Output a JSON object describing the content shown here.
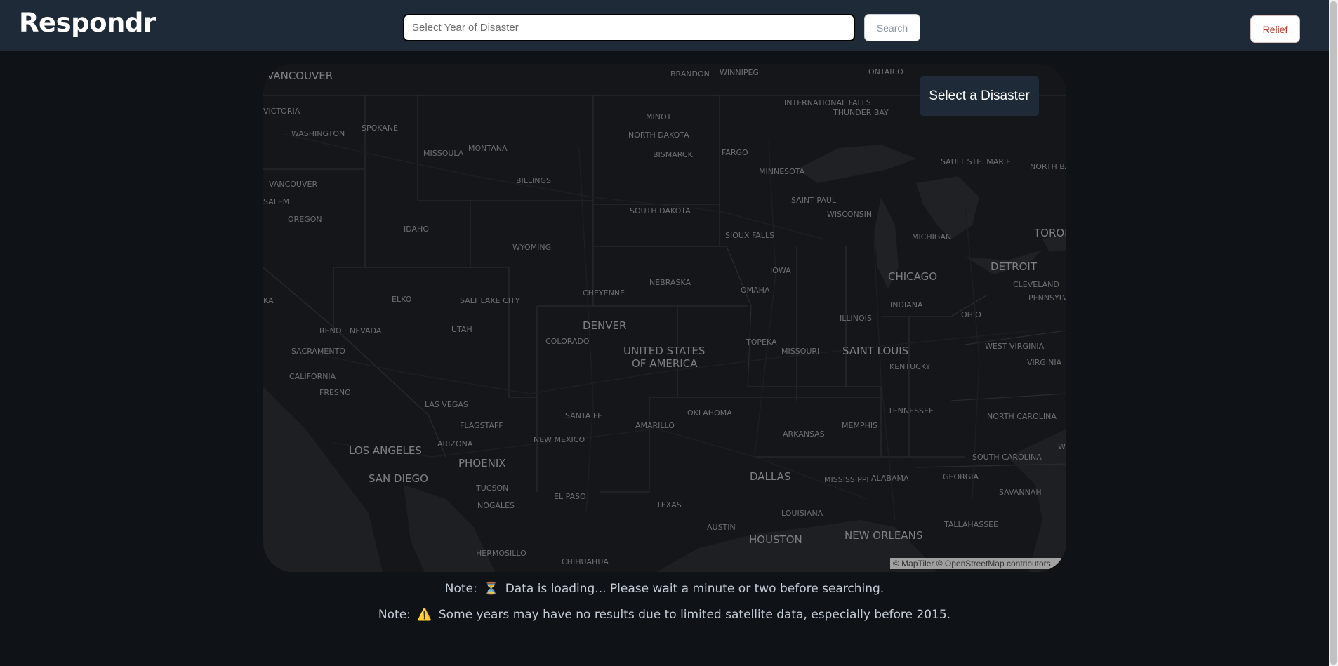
{
  "header": {
    "brand": "Respondr",
    "search_placeholder": "Select Year of Disaster",
    "search_label": "Search",
    "relief_label": "Relief"
  },
  "map": {
    "select_label": "Select a Disaster",
    "attribution": "© MapTiler © OpenStreetMap contributors",
    "labels": {
      "vancouver": "Vancouver",
      "victoria": "Victoria",
      "washington": "Washington",
      "spokane": "Spokane",
      "missoula": "Missoula",
      "montana": "Montana",
      "vancouver_wa": "Vancouver",
      "salem": "Salem",
      "oregon": "Oregon",
      "billings": "Billings",
      "idaho": "Idaho",
      "wyoming": "Wyoming",
      "brandon": "Brandon",
      "winnipeg": "Winnipeg",
      "ontario": "Ontario",
      "minot": "Minot",
      "north_dakota": "North Dakota",
      "bismarck": "Bismarck",
      "fargo": "Fargo",
      "international_falls": "International Falls",
      "thunder_bay": "Thunder Bay",
      "minnesota": "Minnesota",
      "sault_ste_marie": "Sault Ste. Marie",
      "north_bay": "North Ba",
      "south_dakota": "South Dakota",
      "saint_paul": "Saint Paul",
      "wisconsin": "Wisconsin",
      "sioux_falls": "Sioux Falls",
      "michigan": "Michigan",
      "toronto": "Toron",
      "detroit": "Detroit",
      "chicago": "Chicago",
      "cleveland": "Cleveland",
      "pennsylvania": "Pennsylv",
      "iowa": "Iowa",
      "nebraska": "Nebraska",
      "omaha": "Omaha",
      "cheyenne": "Cheyenne",
      "indiana": "Indiana",
      "ohio": "Ohio",
      "illinois": "Illinois",
      "nevada_frag": "ka",
      "elko": "Elko",
      "salt_lake_city": "Salt Lake City",
      "denver": "Denver",
      "reno": "Reno",
      "nevada": "Nevada",
      "utah": "Utah",
      "colorado": "Colorado",
      "topeka": "Topeka",
      "missouri": "Missouri",
      "saint_louis": "Saint Louis",
      "west_virginia": "West Virginia",
      "virginia": "Virginia",
      "kentucky": "Kentucky",
      "sacramento": "Sacramento",
      "california": "California",
      "fresno": "Fresno",
      "usa_line1": "United States",
      "usa_line2": "of America",
      "las_vegas": "Las Vegas",
      "santa_fe": "Santa Fe",
      "oklahoma": "Oklahoma",
      "tennessee": "Tennessee",
      "north_carolina": "North Carolina",
      "flagstaff": "Flagstaff",
      "amarillo": "Amarillo",
      "memphis": "Memphis",
      "arkansas": "Arkansas",
      "arizona": "Arizona",
      "new_mexico": "New Mexico",
      "los_angeles": "Los Angeles",
      "phoenix": "Phoenix",
      "south_carolina": "South Carolina",
      "san_diego": "San Diego",
      "dallas": "Dallas",
      "mississippi": "Mississippi",
      "alabama": "Alabama",
      "georgia": "Georgia",
      "tucson": "Tucson",
      "savannah": "Savannah",
      "el_paso": "El Paso",
      "nogales": "Nogales",
      "texas": "Texas",
      "louisiana": "Louisiana",
      "tallahassee": "Tallahassee",
      "austin": "Austin",
      "new_orleans": "New Orleans",
      "houston": "Houston",
      "hermosillo": "Hermosillo",
      "chihuahua": "Chihuahua",
      "wi_frag": "Wi"
    }
  },
  "notes": {
    "loading_prefix": "Note:",
    "loading_icon": "⏳",
    "loading_text": "Data is loading... Please wait a minute or two before searching.",
    "warning_prefix": "Note:",
    "warning_icon": "⚠️",
    "warning_text": "Some years may have no results due to limited satellite data, especially before 2015."
  },
  "colors": {
    "topbar": "#1f2a38",
    "background": "#0f1217",
    "map_land": "#151619",
    "relief_text": "#c0392b"
  }
}
